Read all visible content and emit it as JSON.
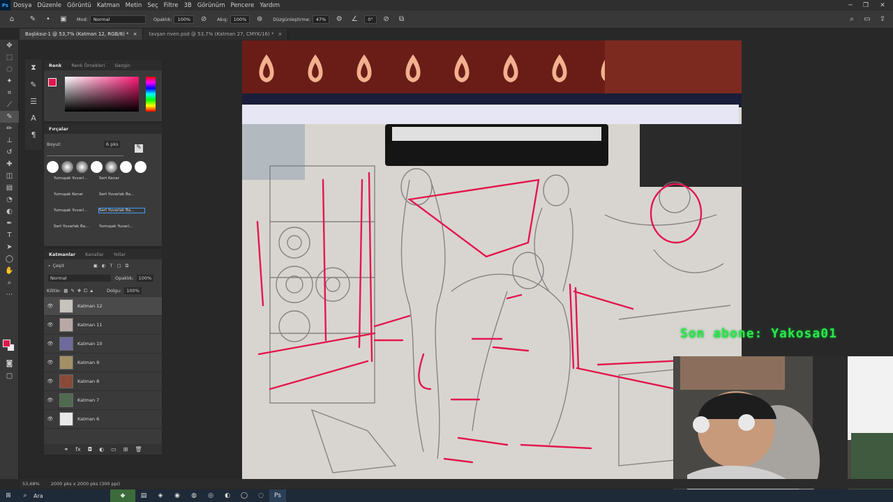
{
  "menubar": {
    "logo": "Ps",
    "items": [
      "Dosya",
      "Düzenle",
      "Görüntü",
      "Katman",
      "Metin",
      "Seç",
      "Filtre",
      "3B",
      "Görünüm",
      "Pencere",
      "Yardım"
    ]
  },
  "options": {
    "mode_label": "Mod:",
    "mode_value": "Normal",
    "opacity_label": "Opaklık:",
    "opacity_value": "100%",
    "flow_label": "Akış:",
    "flow_value": "100%",
    "smoothing_label": "Düzgünleştirme:",
    "smoothing_value": "47%",
    "angle_value": "0°"
  },
  "tabs": [
    {
      "label": "Başlıksız-1 @ 53,7% (Katman 12, RGB/8) *"
    },
    {
      "label": "tavşan riven.psd @ 53,7% (Katman 27, CMYK/16) *"
    }
  ],
  "color_panel": {
    "tabs": [
      "Renk",
      "Renk Örnekleri",
      "Gezgin"
    ],
    "fg_color": "#e0174f"
  },
  "brush_panel": {
    "title": "Fırçalar",
    "size_label": "Boyut:",
    "size_value": "6 pks",
    "brushes": [
      "Yumuşak Yuvarl...",
      "Sert Kenar",
      "Yumuşak Kenar",
      "Sert Yuvarlak Ba...",
      "Yumuşak Yuvarl...",
      "Sert Yuvarlak Ba...",
      "Sert Yuvarlak Ba...",
      "Yumuşak Yuvarl..."
    ]
  },
  "layers_panel": {
    "tabs": [
      "Katmanlar",
      "Kanallar",
      "Yollar"
    ],
    "filter_label": "Çeşit",
    "blend_mode": "Normal",
    "opacity_label": "Opaklık:",
    "opacity_value": "100%",
    "lock_label": "Kilitle:",
    "fill_label": "Dolgu:",
    "fill_value": "100%",
    "layers": [
      "Katman 12",
      "Katman 11",
      "Katman 10",
      "Katman 9",
      "Katman 8",
      "Katman 7",
      "Katman 6"
    ]
  },
  "status": {
    "zoom": "53,68%",
    "doc_size": "2000 pks x 2000 pks (300 ppi)"
  },
  "stream_overlay": {
    "text": "Son abone: Yakosa01"
  },
  "taskbar": {
    "search_placeholder": "Ara"
  }
}
